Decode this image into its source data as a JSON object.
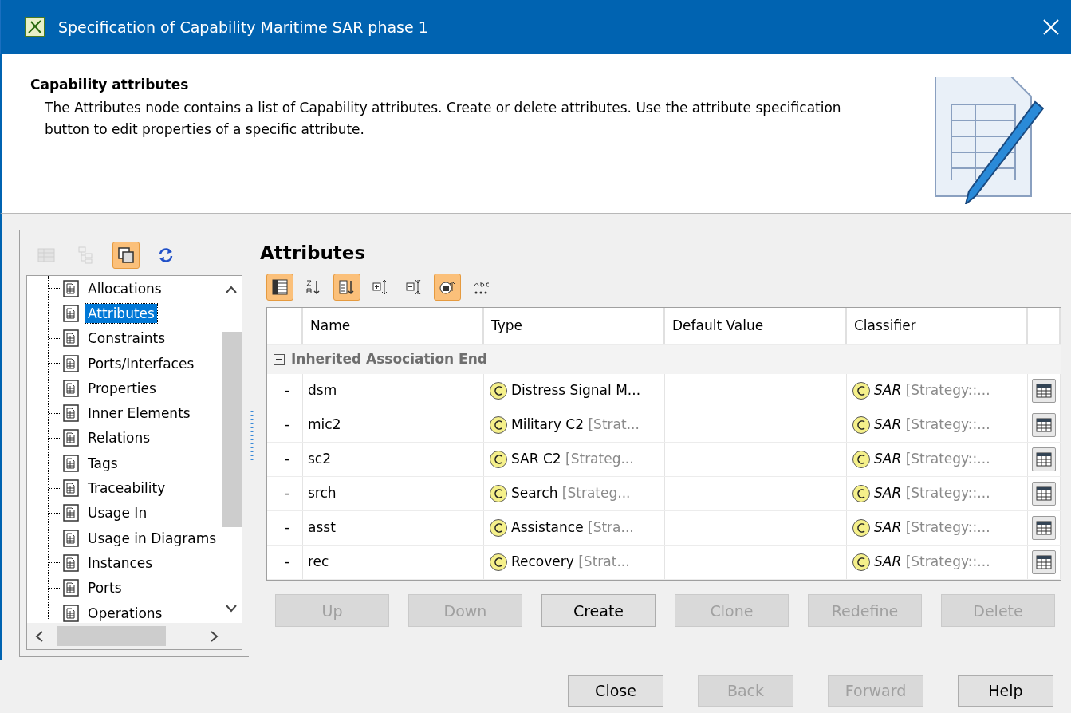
{
  "window": {
    "title": "Specification of Capability Maritime SAR phase 1"
  },
  "header": {
    "title": "Capability attributes",
    "description": "The Attributes node contains a list of Capability attributes. Create or delete attributes. Use the attribute specification button to edit properties of a specific attribute."
  },
  "tree_toolbar": [
    {
      "kind": "table",
      "pressed": false,
      "disabled": true
    },
    {
      "kind": "tree",
      "pressed": false,
      "disabled": true
    },
    {
      "kind": "copy",
      "pressed": true,
      "disabled": false
    },
    {
      "kind": "refresh",
      "pressed": false,
      "disabled": false
    }
  ],
  "tree": {
    "items": [
      {
        "label": "Allocations",
        "selected": false
      },
      {
        "label": "Attributes",
        "selected": true
      },
      {
        "label": "Constraints",
        "selected": false
      },
      {
        "label": "Ports/Interfaces",
        "selected": false
      },
      {
        "label": "Properties",
        "selected": false
      },
      {
        "label": "Inner Elements",
        "selected": false
      },
      {
        "label": "Relations",
        "selected": false
      },
      {
        "label": "Tags",
        "selected": false
      },
      {
        "label": "Traceability",
        "selected": false
      },
      {
        "label": "Usage In",
        "selected": false
      },
      {
        "label": "Usage in Diagrams",
        "selected": false
      },
      {
        "label": "Instances",
        "selected": false
      },
      {
        "label": "Ports",
        "selected": false
      },
      {
        "label": "Operations",
        "selected": false
      }
    ]
  },
  "section_title": "Attributes",
  "table_toolbar": [
    {
      "kind": "columns",
      "pressed": true
    },
    {
      "kind": "sort-alpha",
      "pressed": false
    },
    {
      "kind": "sort-list",
      "pressed": true
    },
    {
      "kind": "expand",
      "pressed": false
    },
    {
      "kind": "collapse",
      "pressed": false
    },
    {
      "kind": "inherited",
      "pressed": true
    },
    {
      "kind": "abc",
      "pressed": false
    }
  ],
  "table": {
    "columns": [
      "Name",
      "Type",
      "Default Value",
      "Classifier"
    ],
    "group": {
      "label": "Inherited Association End",
      "expanded": true
    },
    "rows": [
      {
        "visibility": "-",
        "name": "dsm",
        "type": "Distress Signal M...",
        "type_owner": "",
        "default_value": "",
        "classifier": "SAR",
        "classifier_owner": "[Strategy::..."
      },
      {
        "visibility": "-",
        "name": "mic2",
        "type": "Military C2",
        "type_owner": "[Strat...",
        "default_value": "",
        "classifier": "SAR",
        "classifier_owner": "[Strategy::..."
      },
      {
        "visibility": "-",
        "name": "sc2",
        "type": "SAR C2",
        "type_owner": "[Strateg...",
        "default_value": "",
        "classifier": "SAR",
        "classifier_owner": "[Strategy::..."
      },
      {
        "visibility": "-",
        "name": "srch",
        "type": "Search",
        "type_owner": "[Strateg...",
        "default_value": "",
        "classifier": "SAR",
        "classifier_owner": "[Strategy::..."
      },
      {
        "visibility": "-",
        "name": "asst",
        "type": "Assistance",
        "type_owner": "[Stra...",
        "default_value": "",
        "classifier": "SAR",
        "classifier_owner": "[Strategy::..."
      },
      {
        "visibility": "-",
        "name": "rec",
        "type": "Recovery",
        "type_owner": "[Strat...",
        "default_value": "",
        "classifier": "SAR",
        "classifier_owner": "[Strategy::..."
      }
    ]
  },
  "table_buttons": [
    {
      "label": "Up",
      "disabled": true
    },
    {
      "label": "Down",
      "disabled": true
    },
    {
      "label": "Create",
      "disabled": false
    },
    {
      "label": "Clone",
      "disabled": true
    },
    {
      "label": "Redefine",
      "disabled": true
    },
    {
      "label": "Delete",
      "disabled": true
    }
  ],
  "dialog_buttons": [
    {
      "label": "Close",
      "disabled": false
    },
    {
      "label": "Back",
      "disabled": true
    },
    {
      "label": "Forward",
      "disabled": true
    },
    {
      "label": "Help",
      "disabled": false
    }
  ]
}
